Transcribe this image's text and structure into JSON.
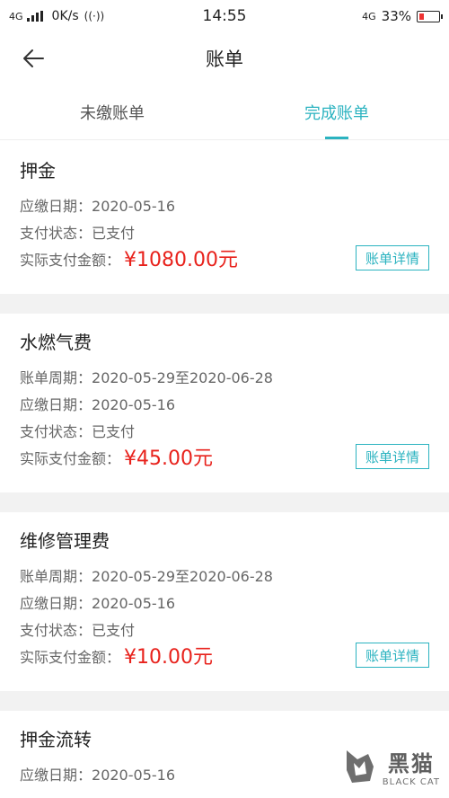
{
  "status_bar": {
    "network_left": "4G",
    "speed": "0K/s",
    "time": "14:55",
    "network_right": "4G",
    "battery": "33%"
  },
  "header": {
    "title": "账单"
  },
  "tabs": [
    {
      "label": "未缴账单",
      "active": false
    },
    {
      "label": "完成账单",
      "active": true
    }
  ],
  "labels": {
    "due_date": "应缴日期：",
    "period": "账单周期：",
    "pay_status": "支付状态：",
    "amount": "实际支付金额：",
    "detail_button": "账单详情"
  },
  "bills": [
    {
      "title": "押金",
      "due_date": "2020-05-16",
      "pay_status": "已支付",
      "amount": "¥1080.00元"
    },
    {
      "title": "水燃气费",
      "period": "2020-05-29至2020-06-28",
      "due_date": "2020-05-16",
      "pay_status": "已支付",
      "amount": "¥45.00元"
    },
    {
      "title": "维修管理费",
      "period": "2020-05-29至2020-06-28",
      "due_date": "2020-05-16",
      "pay_status": "已支付",
      "amount": "¥10.00元"
    },
    {
      "title": "押金流转",
      "due_date": "2020-05-16"
    }
  ],
  "watermark": {
    "cn": "黑猫",
    "en": "BLACK CAT"
  },
  "colors": {
    "accent": "#2bb3c0",
    "amount": "#e8221c",
    "background": "#f2f2f2"
  }
}
